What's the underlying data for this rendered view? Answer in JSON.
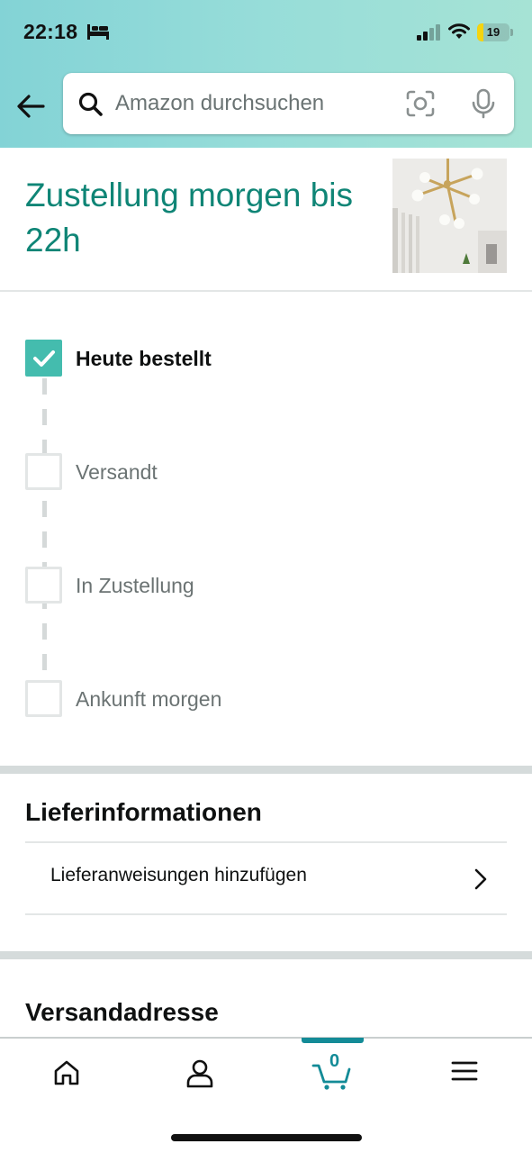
{
  "status_bar": {
    "time": "22:18",
    "battery_level": "19",
    "battery_fraction": 0.19
  },
  "search": {
    "placeholder": "Amazon durchsuchen"
  },
  "icons": {
    "back": "arrow-left-icon",
    "search": "search-icon",
    "camera": "camera-scan-icon",
    "mic": "microphone-icon",
    "home": "home-icon",
    "account": "person-icon",
    "cart": "cart-icon",
    "menu": "hamburger-menu-icon"
  },
  "delivery": {
    "title": "Zustellung morgen bis 22h"
  },
  "tracking": {
    "steps": [
      {
        "label": "Heute bestellt",
        "done": true
      },
      {
        "label": "Versandt",
        "done": false
      },
      {
        "label": "In Zustellung",
        "done": false
      },
      {
        "label": "Ankunft morgen",
        "done": false
      }
    ]
  },
  "delivery_info": {
    "title": "Lieferinformationen",
    "add_instructions": "Lieferanweisungen hinzufügen"
  },
  "address": {
    "title": "Versandadresse"
  },
  "bottom_nav": {
    "cart_count": "0",
    "active_tab": "cart"
  },
  "colors": {
    "accent": "#0f8576",
    "check_done": "#44bcae",
    "cart_active": "#138b97"
  }
}
